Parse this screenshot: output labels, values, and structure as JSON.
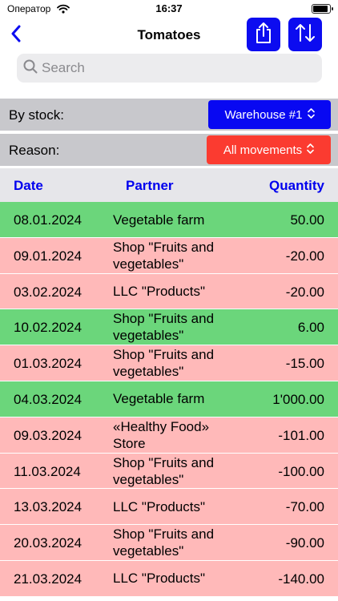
{
  "status_bar": {
    "carrier": "Оператор",
    "time": "16:37",
    "battery_fraction": 0.95
  },
  "nav": {
    "title": "Tomatoes"
  },
  "search": {
    "placeholder": "Search"
  },
  "filters": {
    "stock_label": "By stock:",
    "stock_value": "Warehouse #1",
    "reason_label": "Reason:",
    "reason_value": "All movements"
  },
  "table": {
    "headers": {
      "date": "Date",
      "partner": "Partner",
      "quantity": "Quantity"
    },
    "rows": [
      {
        "date": "08.01.2024",
        "partner": "Vegetable farm",
        "quantity": "50.00",
        "type": "in"
      },
      {
        "date": "09.01.2024",
        "partner": "Shop \"Fruits and vegetables\"",
        "quantity": "-20.00",
        "type": "out"
      },
      {
        "date": "03.02.2024",
        "partner": "LLC \"Products\"",
        "quantity": "-20.00",
        "type": "out"
      },
      {
        "date": "10.02.2024",
        "partner": "Shop \"Fruits and vegetables\"",
        "quantity": "6.00",
        "type": "in"
      },
      {
        "date": "01.03.2024",
        "partner": "Shop \"Fruits and vegetables\"",
        "quantity": "-15.00",
        "type": "out"
      },
      {
        "date": "04.03.2024",
        "partner": "Vegetable farm",
        "quantity": "1'000.00",
        "type": "in"
      },
      {
        "date": "09.03.2024",
        "partner": "«Healthy Food» Store",
        "quantity": "-101.00",
        "type": "out"
      },
      {
        "date": "11.03.2024",
        "partner": "Shop \"Fruits and vegetables\"",
        "quantity": "-100.00",
        "type": "out"
      },
      {
        "date": "13.03.2024",
        "partner": "LLC \"Products\"",
        "quantity": "-70.00",
        "type": "out"
      },
      {
        "date": "20.03.2024",
        "partner": "Shop \"Fruits and vegetables\"",
        "quantity": "-90.00",
        "type": "out"
      },
      {
        "date": "21.03.2024",
        "partner": "LLC \"Products\"",
        "quantity": "-140.00",
        "type": "out"
      }
    ]
  },
  "colors": {
    "accent_blue": "#0c0cf0",
    "reason_red": "#fb3b30",
    "incoming_row": "#6bd67b",
    "outgoing_row": "#ffb9b9",
    "header_text": "#0000ee"
  },
  "icons": {
    "back": "chevron-left-icon",
    "share": "share-icon",
    "sort": "sort-arrows-icon",
    "search": "search-icon",
    "dropdown": "chevron-up-down-icon"
  }
}
